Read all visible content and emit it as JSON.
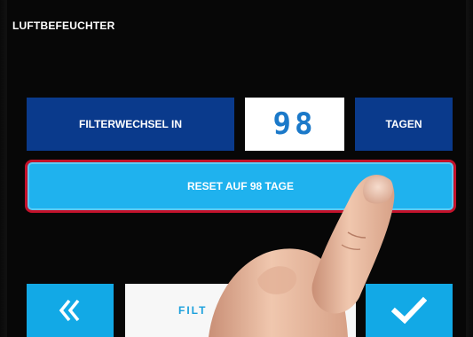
{
  "header": {
    "title": "LUFTBEFEUCHTER"
  },
  "filter": {
    "label": "FILTERWECHSEL IN",
    "value": "98",
    "unit": "TAGEN"
  },
  "reset_button": {
    "label": "RESET AUF 98 TAGE"
  },
  "bottom_bar": {
    "back_icon": "double-chevron-left-icon",
    "middle_label": "FILT",
    "confirm_icon": "checkmark-icon"
  },
  "colors": {
    "dark_tile": "#0a3a8c",
    "light_tile": "#12a9e6",
    "reset_border": "#c4122b",
    "value_text": "#1b79c9",
    "background": "#070707"
  }
}
